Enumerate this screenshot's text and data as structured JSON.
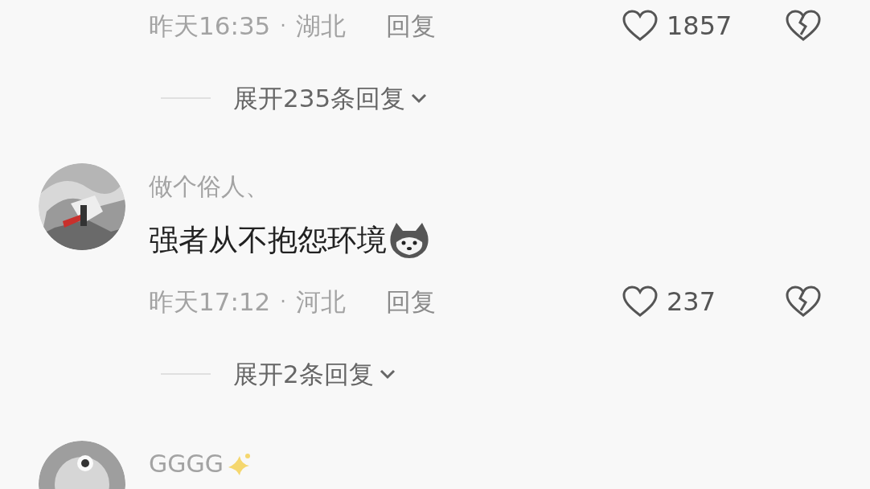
{
  "comments": [
    {
      "kind": "tail",
      "meta": {
        "time": "昨天16:35",
        "separator": "·",
        "location": "湖北",
        "reply": "回复",
        "likes": "1857",
        "liked": false
      },
      "expand": "展开235条回复"
    },
    {
      "kind": "full",
      "username": "做个俗人、",
      "text": "强者从不抱怨环境",
      "text_sticker": true,
      "meta": {
        "time": "昨天17:12",
        "separator": "·",
        "location": "河北",
        "reply": "回复",
        "likes": "237",
        "liked": false
      },
      "expand": "展开2条回复"
    },
    {
      "kind": "head",
      "username": "GGGG",
      "name_sticker": true
    }
  ]
}
